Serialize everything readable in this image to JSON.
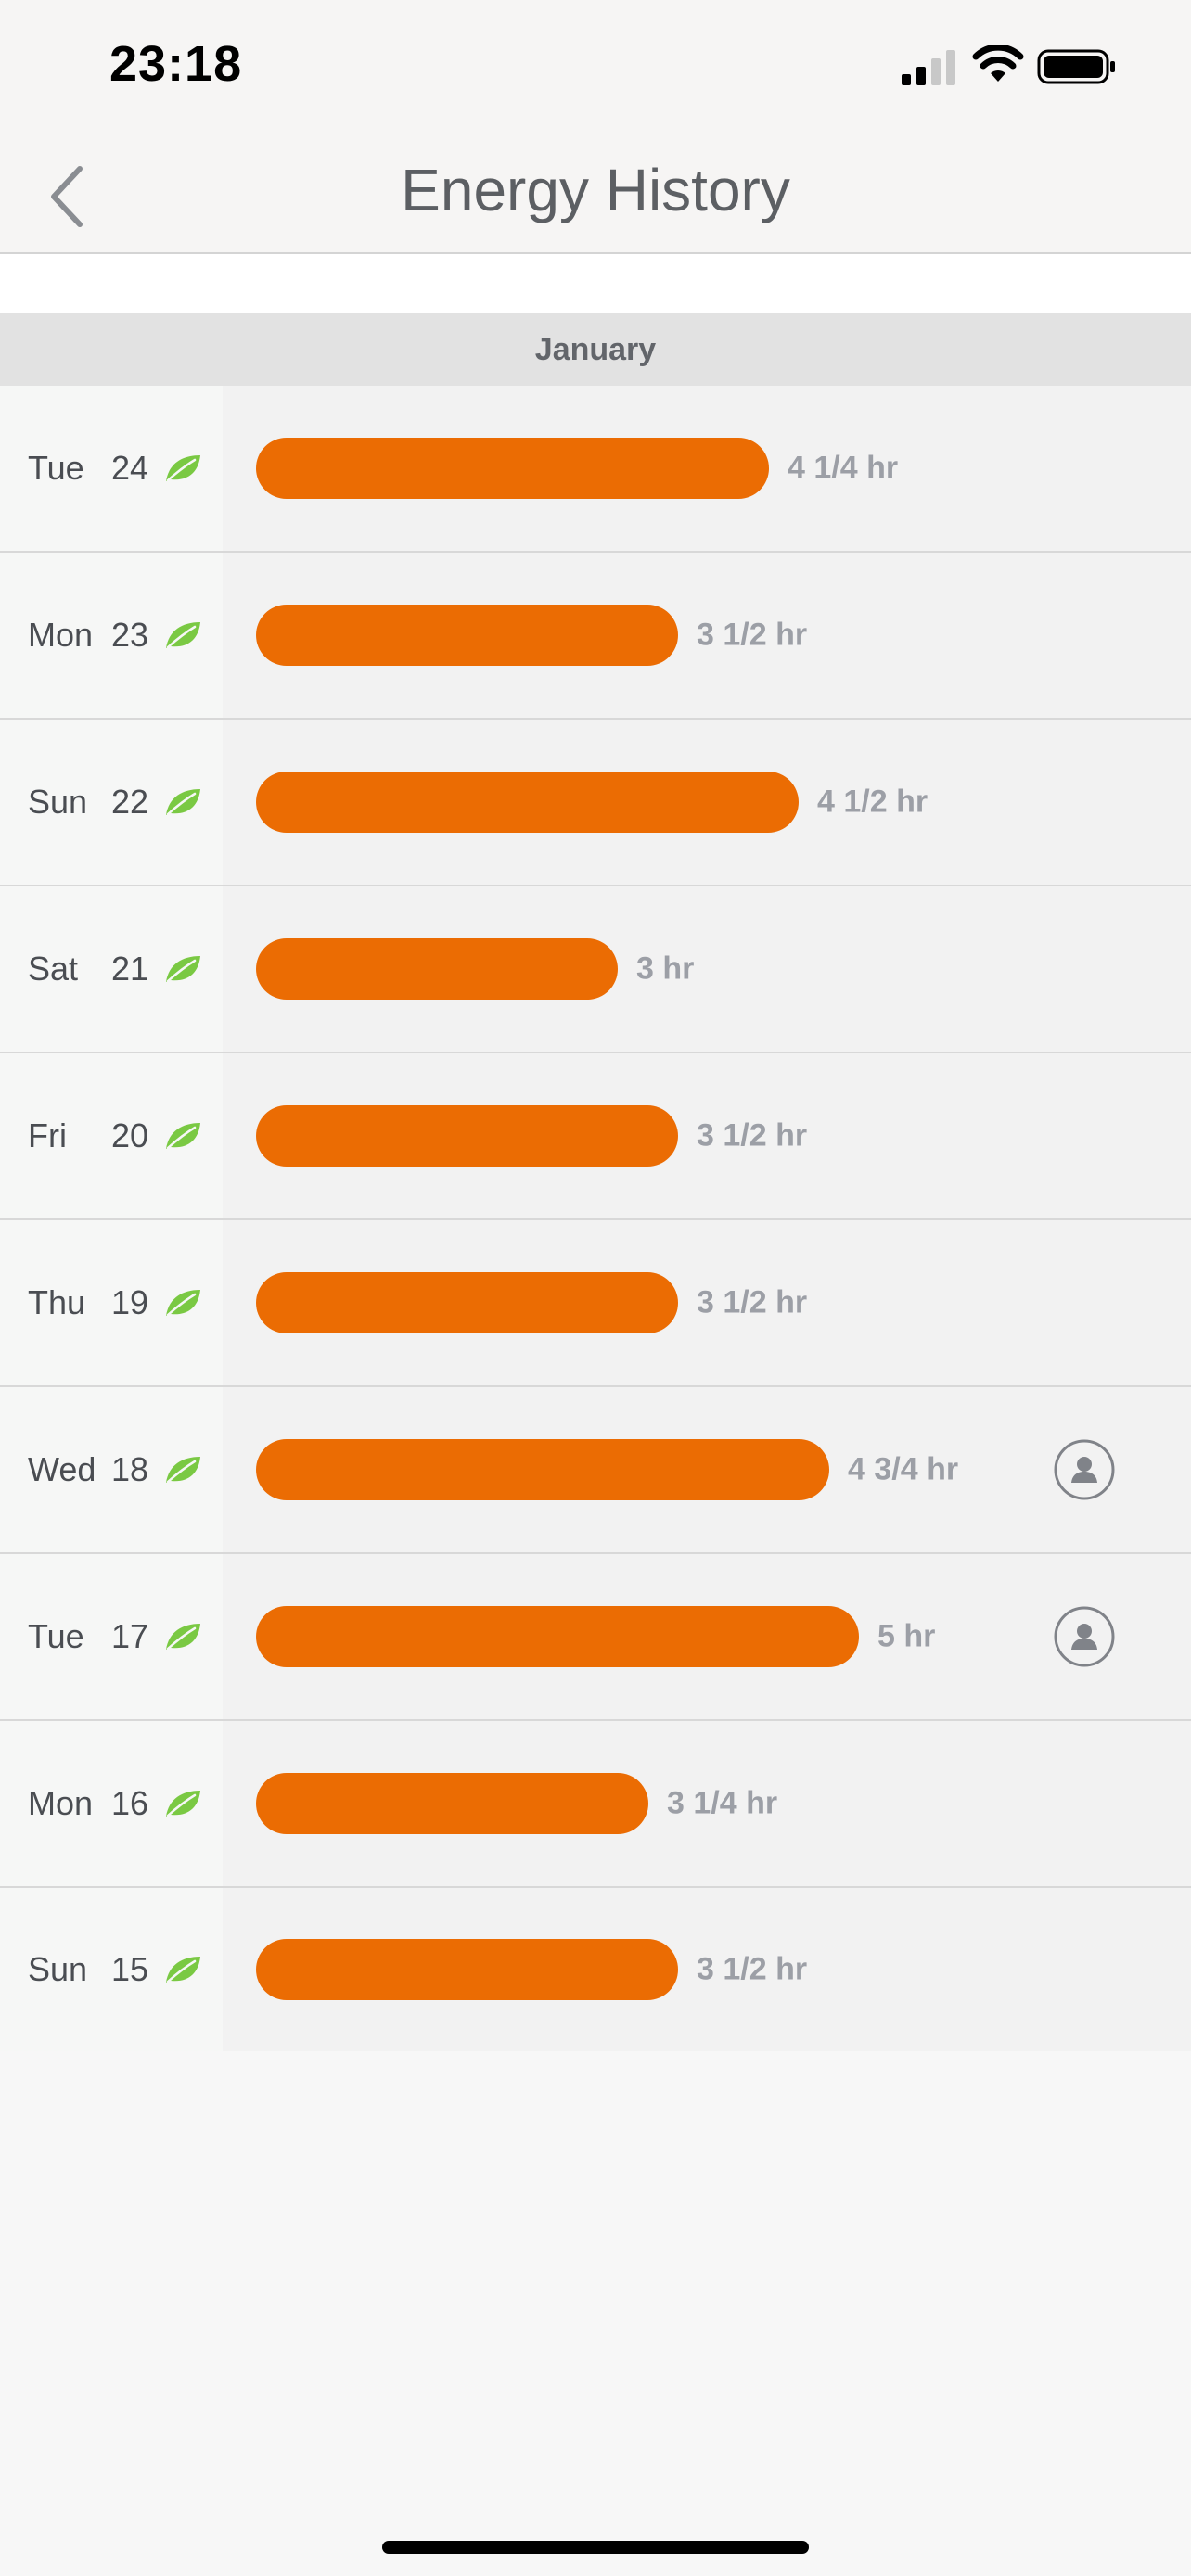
{
  "status_bar": {
    "time": "23:18"
  },
  "header": {
    "title": "Energy History",
    "back_icon": "chevron-left-icon"
  },
  "section": {
    "month": "January"
  },
  "bar_color": "#eb6c03",
  "leaf_color": "#7ac943",
  "max_hours": 5,
  "days": [
    {
      "dow": "Tue",
      "day": "24",
      "hours": 4.25,
      "label": "4 1/4  hr",
      "user_icon": false
    },
    {
      "dow": "Mon",
      "day": "23",
      "hours": 3.5,
      "label": "3 1/2  hr",
      "user_icon": false
    },
    {
      "dow": "Sun",
      "day": "22",
      "hours": 4.5,
      "label": "4 1/2  hr",
      "user_icon": false
    },
    {
      "dow": "Sat",
      "day": "21",
      "hours": 3,
      "label": "3  hr",
      "user_icon": false
    },
    {
      "dow": "Fri",
      "day": "20",
      "hours": 3.5,
      "label": "3 1/2  hr",
      "user_icon": false
    },
    {
      "dow": "Thu",
      "day": "19",
      "hours": 3.5,
      "label": "3 1/2  hr",
      "user_icon": false
    },
    {
      "dow": "Wed",
      "day": "18",
      "hours": 4.75,
      "label": "4 3/4  hr",
      "user_icon": true
    },
    {
      "dow": "Tue",
      "day": "17",
      "hours": 5,
      "label": "5  hr",
      "user_icon": true
    },
    {
      "dow": "Mon",
      "day": "16",
      "hours": 3.25,
      "label": "3 1/4  hr",
      "user_icon": false
    },
    {
      "dow": "Sun",
      "day": "15",
      "hours": 3.5,
      "label": "3 1/2  hr",
      "user_icon": false
    }
  ]
}
